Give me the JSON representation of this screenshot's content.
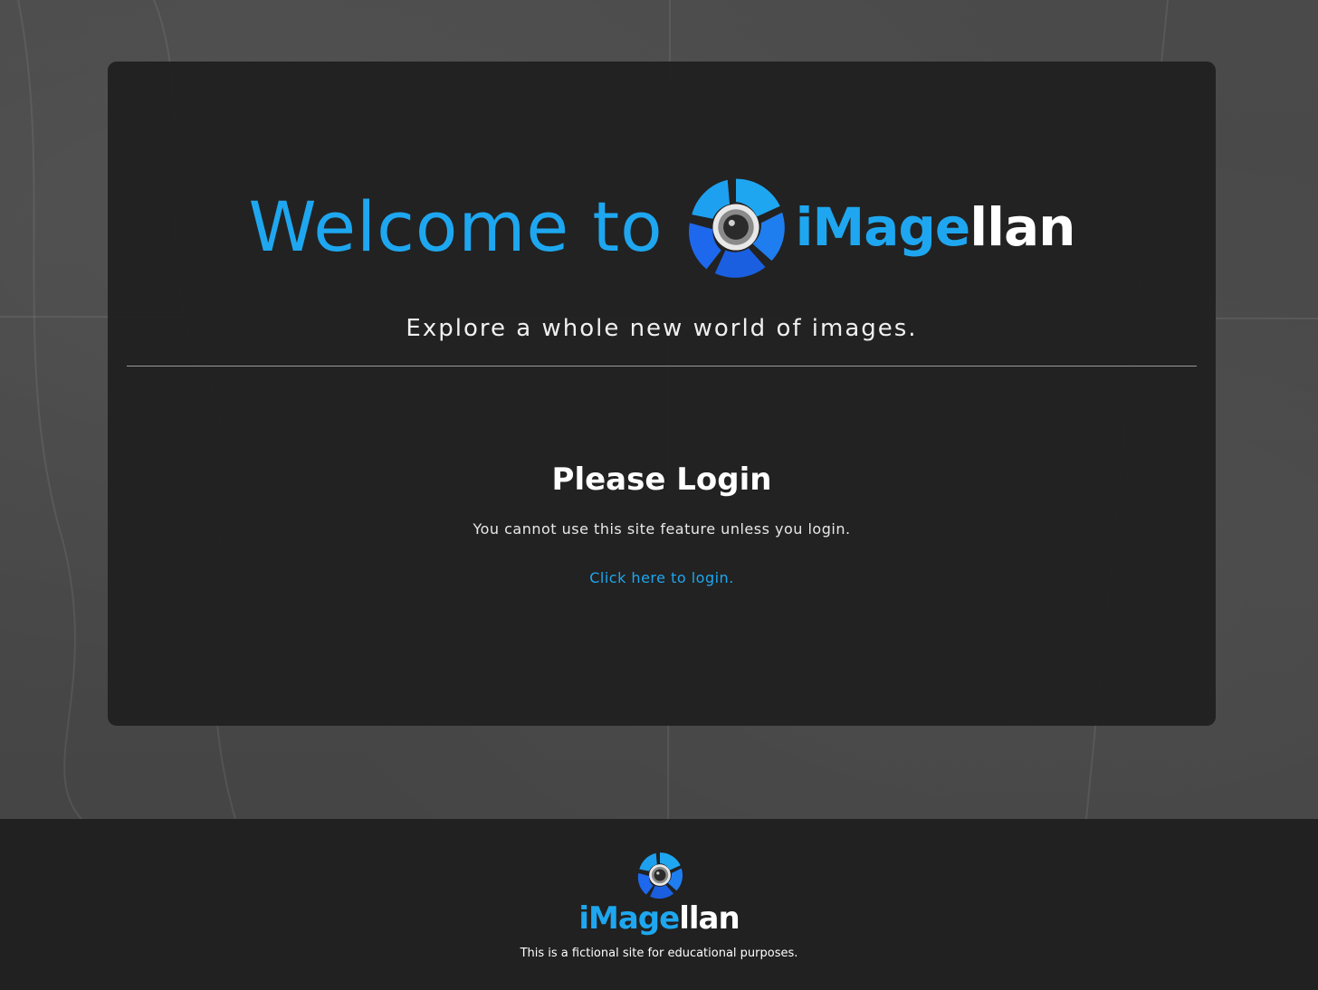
{
  "hero": {
    "welcome": "Welcome to",
    "brand_part1": "iMage",
    "brand_part2": "llan",
    "tagline": "Explore a whole new world of images."
  },
  "login": {
    "title": "Please Login",
    "message": "You cannot use this site feature unless you login.",
    "link_label": "Click here to login."
  },
  "footer": {
    "brand_part1": "iMage",
    "brand_part2": "llan",
    "note": "This is a fictional site for educational purposes."
  },
  "colors": {
    "accent": "#1ea7f0",
    "panel": "#212121",
    "page_bg": "#474747"
  },
  "icons": [
    "camera-aperture-logo-icon"
  ]
}
